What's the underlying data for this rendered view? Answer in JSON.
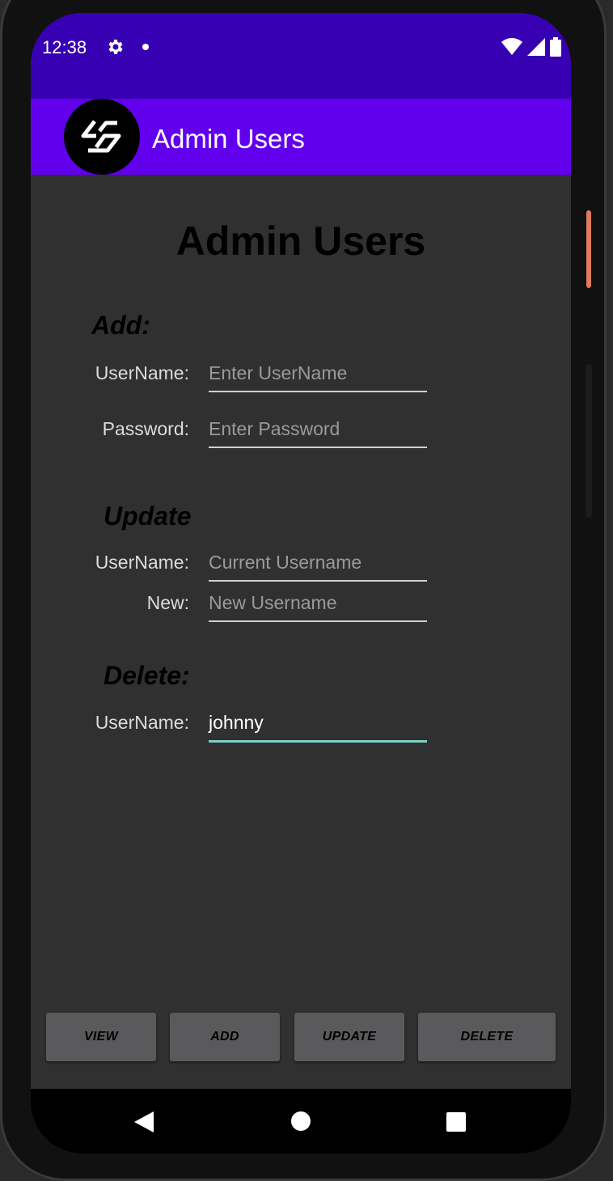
{
  "status_bar": {
    "time": "12:38",
    "icons": [
      "settings-icon",
      "notification-dot-icon",
      "wifi-icon",
      "signal-icon",
      "battery-icon"
    ]
  },
  "app_bar": {
    "title": "Admin Users",
    "logo_icon": "app-logo-icon"
  },
  "page": {
    "heading": "Admin Users",
    "add": {
      "heading": "Add:",
      "username_label": "UserName:",
      "username_placeholder": "Enter UserName",
      "password_label": "Password:",
      "password_placeholder": "Enter Password"
    },
    "update": {
      "heading": "Update",
      "username_label": "UserName:",
      "username_placeholder": "Current Username",
      "new_label": "New:",
      "new_placeholder": "New Username"
    },
    "delete": {
      "heading": "Delete:",
      "username_label": "UserName:",
      "username_value": "johnny"
    }
  },
  "buttons": {
    "view": "VIEW",
    "add": "ADD",
    "update": "UPDATE",
    "delete": "DELETE"
  },
  "nav": {
    "icons": [
      "back-icon",
      "home-icon",
      "recents-icon"
    ]
  },
  "colors": {
    "status_bar": "#3700b3",
    "app_bar": "#6200ee",
    "background": "#303030",
    "focused_underline": "#7fcfc5"
  }
}
